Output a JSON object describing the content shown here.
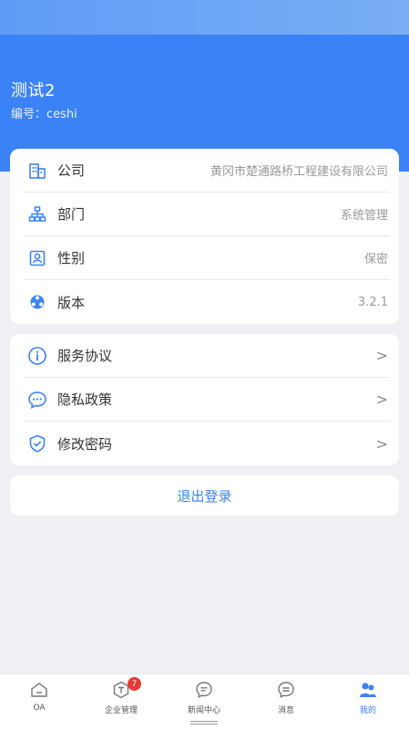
{
  "profile": {
    "name": "测试2",
    "id_line": "编号：ceshi"
  },
  "info": [
    {
      "label": "公司",
      "value": "黄冈市楚通路桥工程建设有限公司",
      "icon": "building-icon"
    },
    {
      "label": "部门",
      "value": "系统管理",
      "icon": "org-chart-icon"
    },
    {
      "label": "性别",
      "value": "保密",
      "icon": "id-card-icon"
    },
    {
      "label": "版本",
      "value": "3.2.1",
      "icon": "version-icon"
    }
  ],
  "links": [
    {
      "label": "服务协议",
      "icon": "info-icon"
    },
    {
      "label": "隐私政策",
      "icon": "chat-bubble-icon"
    },
    {
      "label": "修改密码",
      "icon": "shield-check-icon"
    }
  ],
  "chevron": ">",
  "logout_label": "退出登录",
  "tabs": [
    {
      "label": "OA",
      "icon": "home-icon"
    },
    {
      "label": "企业管理",
      "icon": "cube-icon",
      "badge": "7"
    },
    {
      "label": "新闻中心",
      "icon": "news-icon"
    },
    {
      "label": "消息",
      "icon": "message-icon"
    },
    {
      "label": "我的",
      "icon": "user-icon",
      "active": true
    }
  ],
  "colors": {
    "primary": "#3b82f6",
    "badge": "#e53935"
  }
}
